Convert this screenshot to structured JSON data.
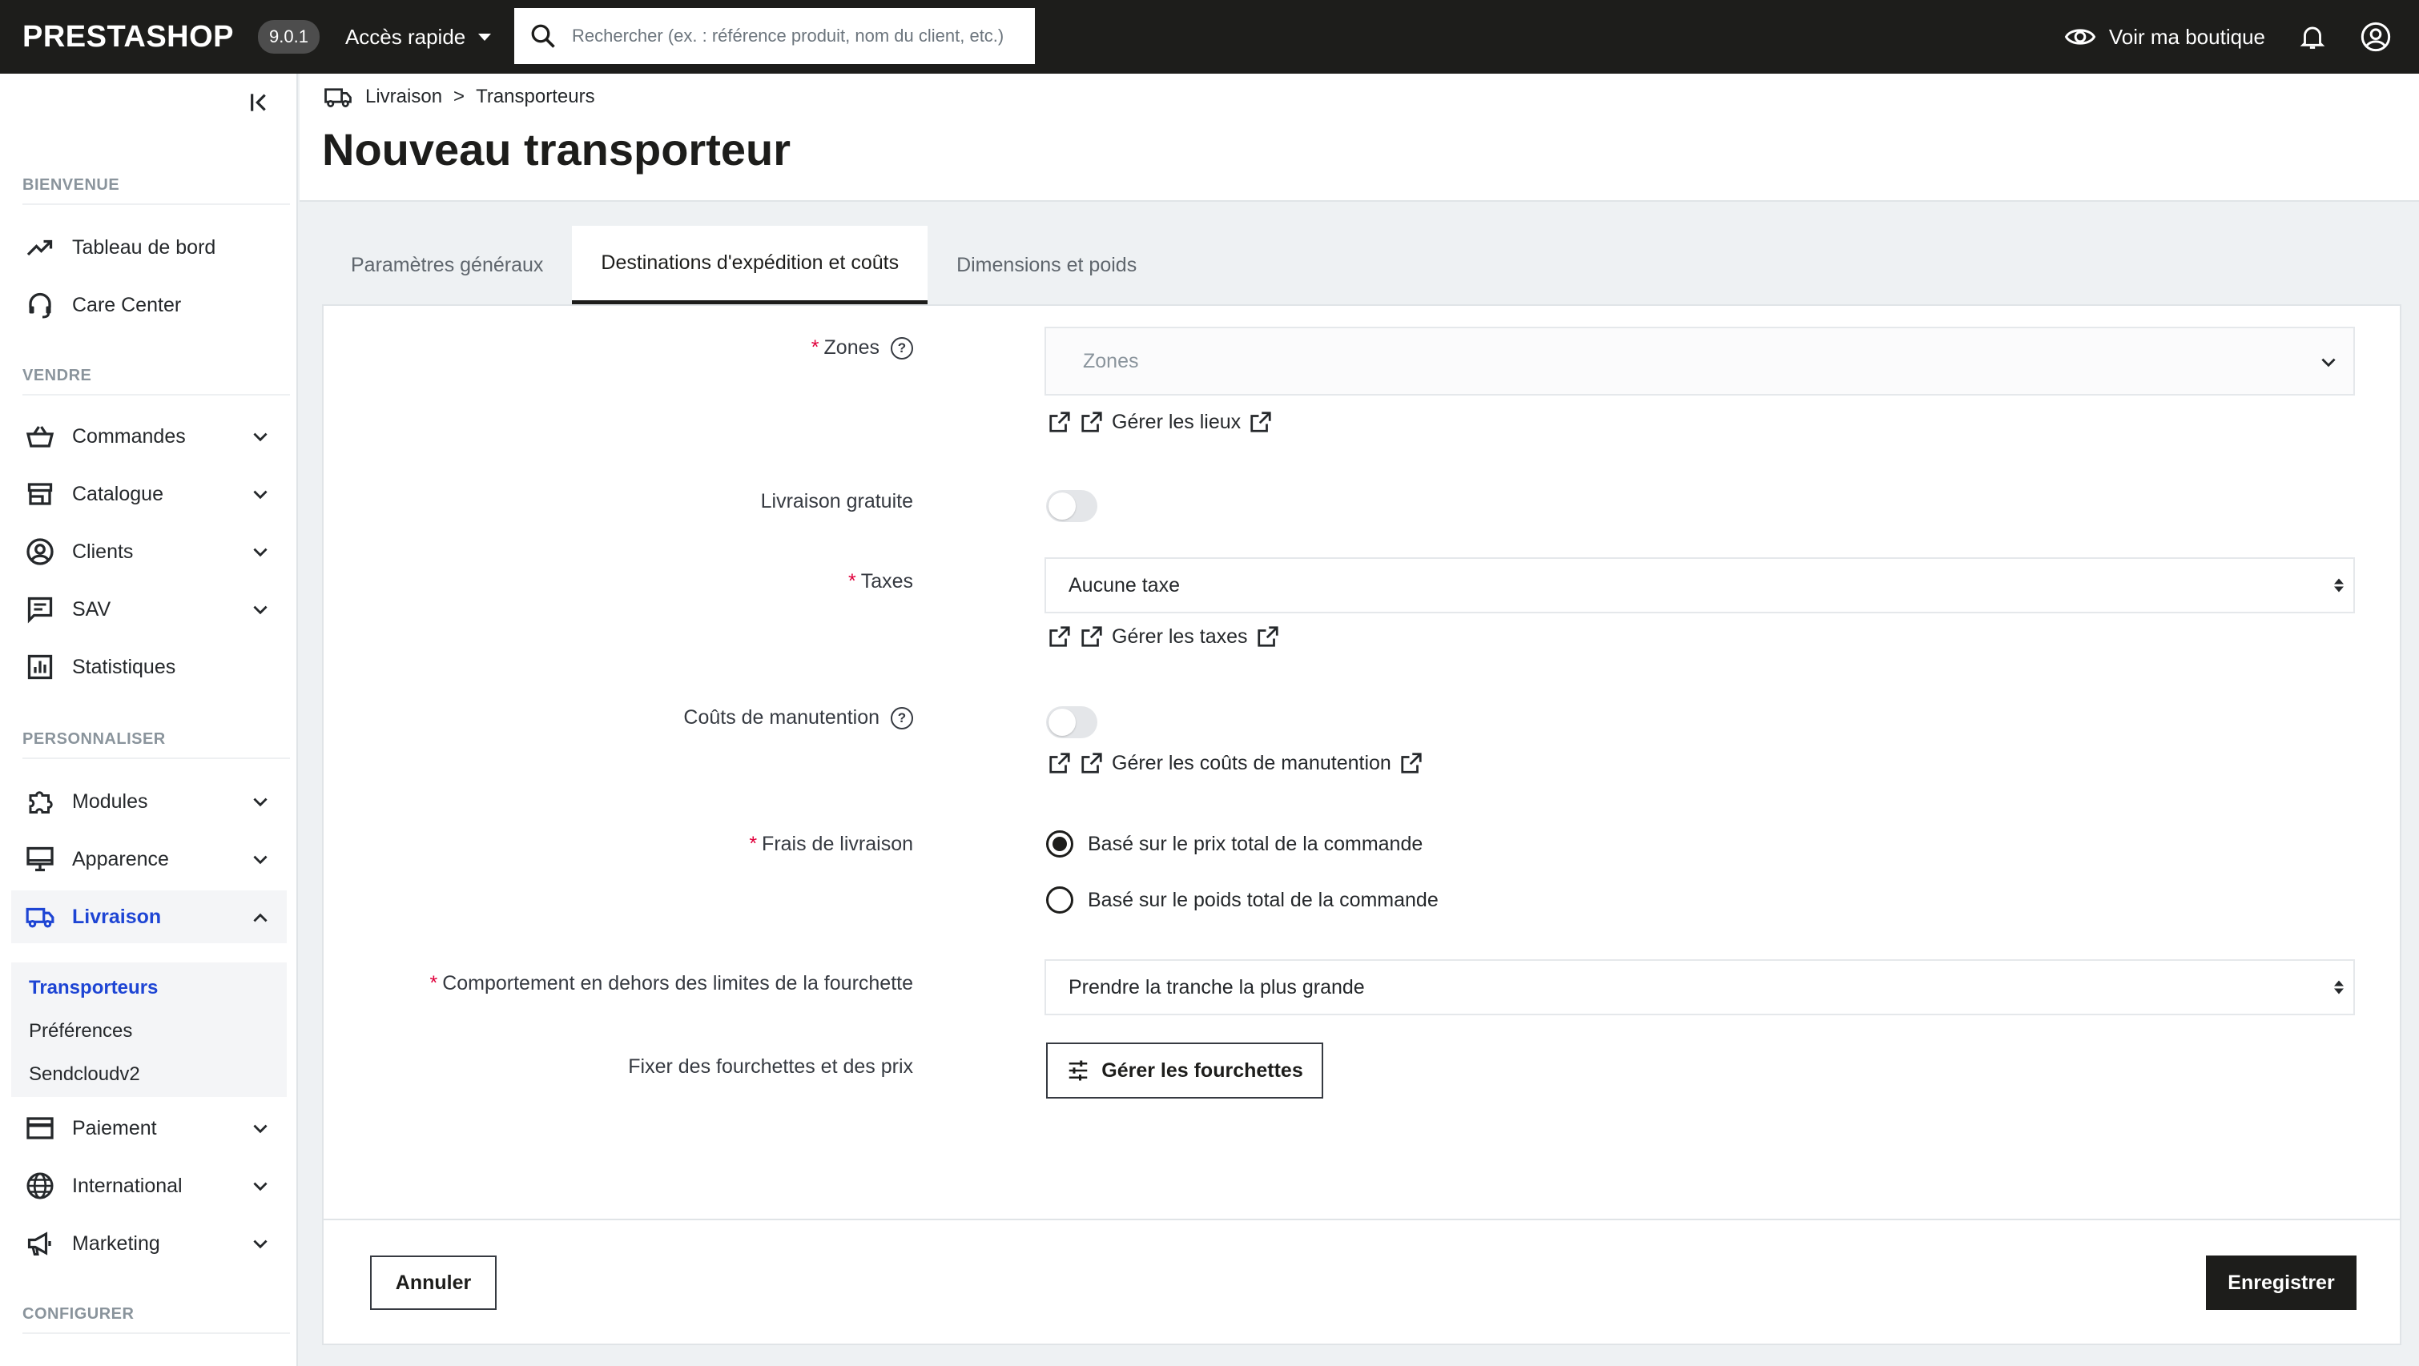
{
  "topbar": {
    "logo": "PRESTASHOP",
    "version": "9.0.1",
    "quick_access": "Accès rapide",
    "search_placeholder": "Rechercher (ex. : référence produit, nom du client, etc.)",
    "view_shop": "Voir ma boutique"
  },
  "sidebar": {
    "sections": {
      "welcome": "BIENVENUE",
      "sell": "VENDRE",
      "customize": "PERSONNALISER",
      "configure": "CONFIGURER"
    },
    "items": {
      "dashboard": "Tableau de bord",
      "care_center": "Care Center",
      "orders": "Commandes",
      "catalog": "Catalogue",
      "customers": "Clients",
      "sav": "SAV",
      "stats": "Statistiques",
      "modules": "Modules",
      "appearance": "Apparence",
      "shipping": "Livraison",
      "payment": "Paiement",
      "international": "International",
      "marketing": "Marketing"
    },
    "shipping_sub": {
      "carriers": "Transporteurs",
      "preferences": "Préférences",
      "sendcloud": "Sendcloudv2"
    }
  },
  "header": {
    "breadcrumb_parent": "Livraison",
    "breadcrumb_sep": ">",
    "breadcrumb_current": "Transporteurs",
    "title": "Nouveau transporteur"
  },
  "tabs": {
    "general": "Paramètres généraux",
    "destinations": "Destinations d'expédition et coûts",
    "dimensions": "Dimensions et poids"
  },
  "form": {
    "required_mark": "*",
    "help_mark": "?",
    "zones_label": "Zones",
    "zones_placeholder": "Zones",
    "manage_places": "Gérer les lieux",
    "free_shipping_label": "Livraison gratuite",
    "free_shipping_on": false,
    "taxes_label": "Taxes",
    "taxes_value": "Aucune taxe",
    "manage_taxes": "Gérer les taxes",
    "handling_label": "Coûts de manutention",
    "handling_on": false,
    "manage_handling": "Gérer les coûts de manutention",
    "shipping_fees_label": "Frais de livraison",
    "fee_option_price": "Basé sur le prix total de la commande",
    "fee_option_weight": "Basé sur le poids total de la commande",
    "fee_selected": "price",
    "out_of_range_label": "Comportement en dehors des limites de la fourchette",
    "out_of_range_value": "Prendre la tranche la plus grande",
    "ranges_label": "Fixer des fourchettes et des prix",
    "ranges_button": "Gérer les fourchettes",
    "cancel": "Annuler",
    "save": "Enregistrer"
  },
  "colors": {
    "topbar": "#1d1d1b",
    "accent": "#1e45d4",
    "required": "#e0003b"
  }
}
